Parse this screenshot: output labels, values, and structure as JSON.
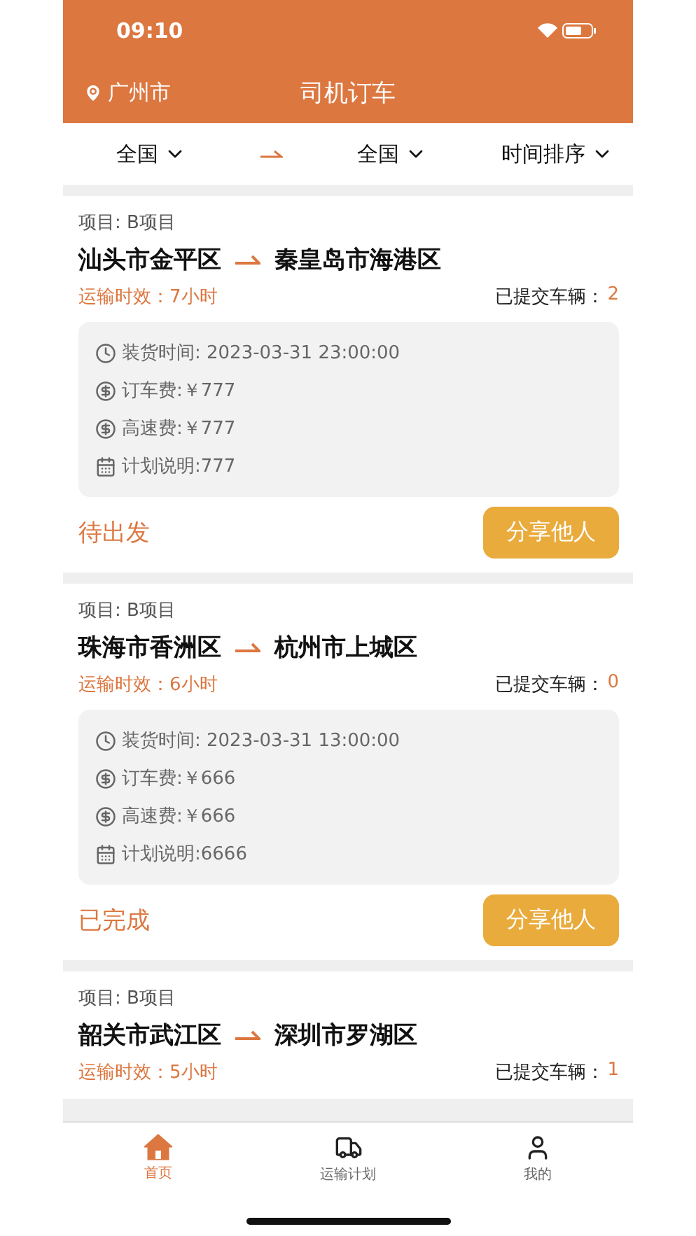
{
  "status_bar": {
    "time": "09:10"
  },
  "header": {
    "location": "广州市",
    "title": "司机订车"
  },
  "filters": {
    "origin": "全国",
    "destination": "全国",
    "sort": "时间排序"
  },
  "orders": [
    {
      "project": "项目: B项目",
      "from": "汕头市金平区",
      "to": "秦皇岛市海港区",
      "duration": "运输时效：7小时",
      "vehicles_label": "已提交车辆：",
      "vehicles": "2",
      "details": [
        {
          "kind": "time",
          "text": "装货时间: 2023-03-31 23:00:00"
        },
        {
          "kind": "money",
          "text": "订车费:￥777"
        },
        {
          "kind": "money",
          "text": "高速费:￥777"
        },
        {
          "kind": "note",
          "text": "计划说明:777"
        }
      ],
      "status": "待出发",
      "share": "分享他人"
    },
    {
      "project": "项目: B项目",
      "from": "珠海市香洲区",
      "to": "杭州市上城区",
      "duration": "运输时效：6小时",
      "vehicles_label": "已提交车辆：",
      "vehicles": "0",
      "details": [
        {
          "kind": "time",
          "text": "装货时间: 2023-03-31 13:00:00"
        },
        {
          "kind": "money",
          "text": "订车费:￥666"
        },
        {
          "kind": "money",
          "text": "高速费:￥666"
        },
        {
          "kind": "note",
          "text": "计划说明:6666"
        }
      ],
      "status": "已完成",
      "share": "分享他人"
    },
    {
      "project": "项目: B项目",
      "from": "韶关市武江区",
      "to": "深圳市罗湖区",
      "duration": "运输时效：5小时",
      "vehicles_label": "已提交车辆：",
      "vehicles": "1"
    }
  ],
  "tabs": [
    {
      "label": "首页",
      "kind": "home",
      "selected": true
    },
    {
      "label": "运输计划",
      "kind": "truck",
      "selected": false
    },
    {
      "label": "我的",
      "kind": "user",
      "selected": false
    }
  ]
}
